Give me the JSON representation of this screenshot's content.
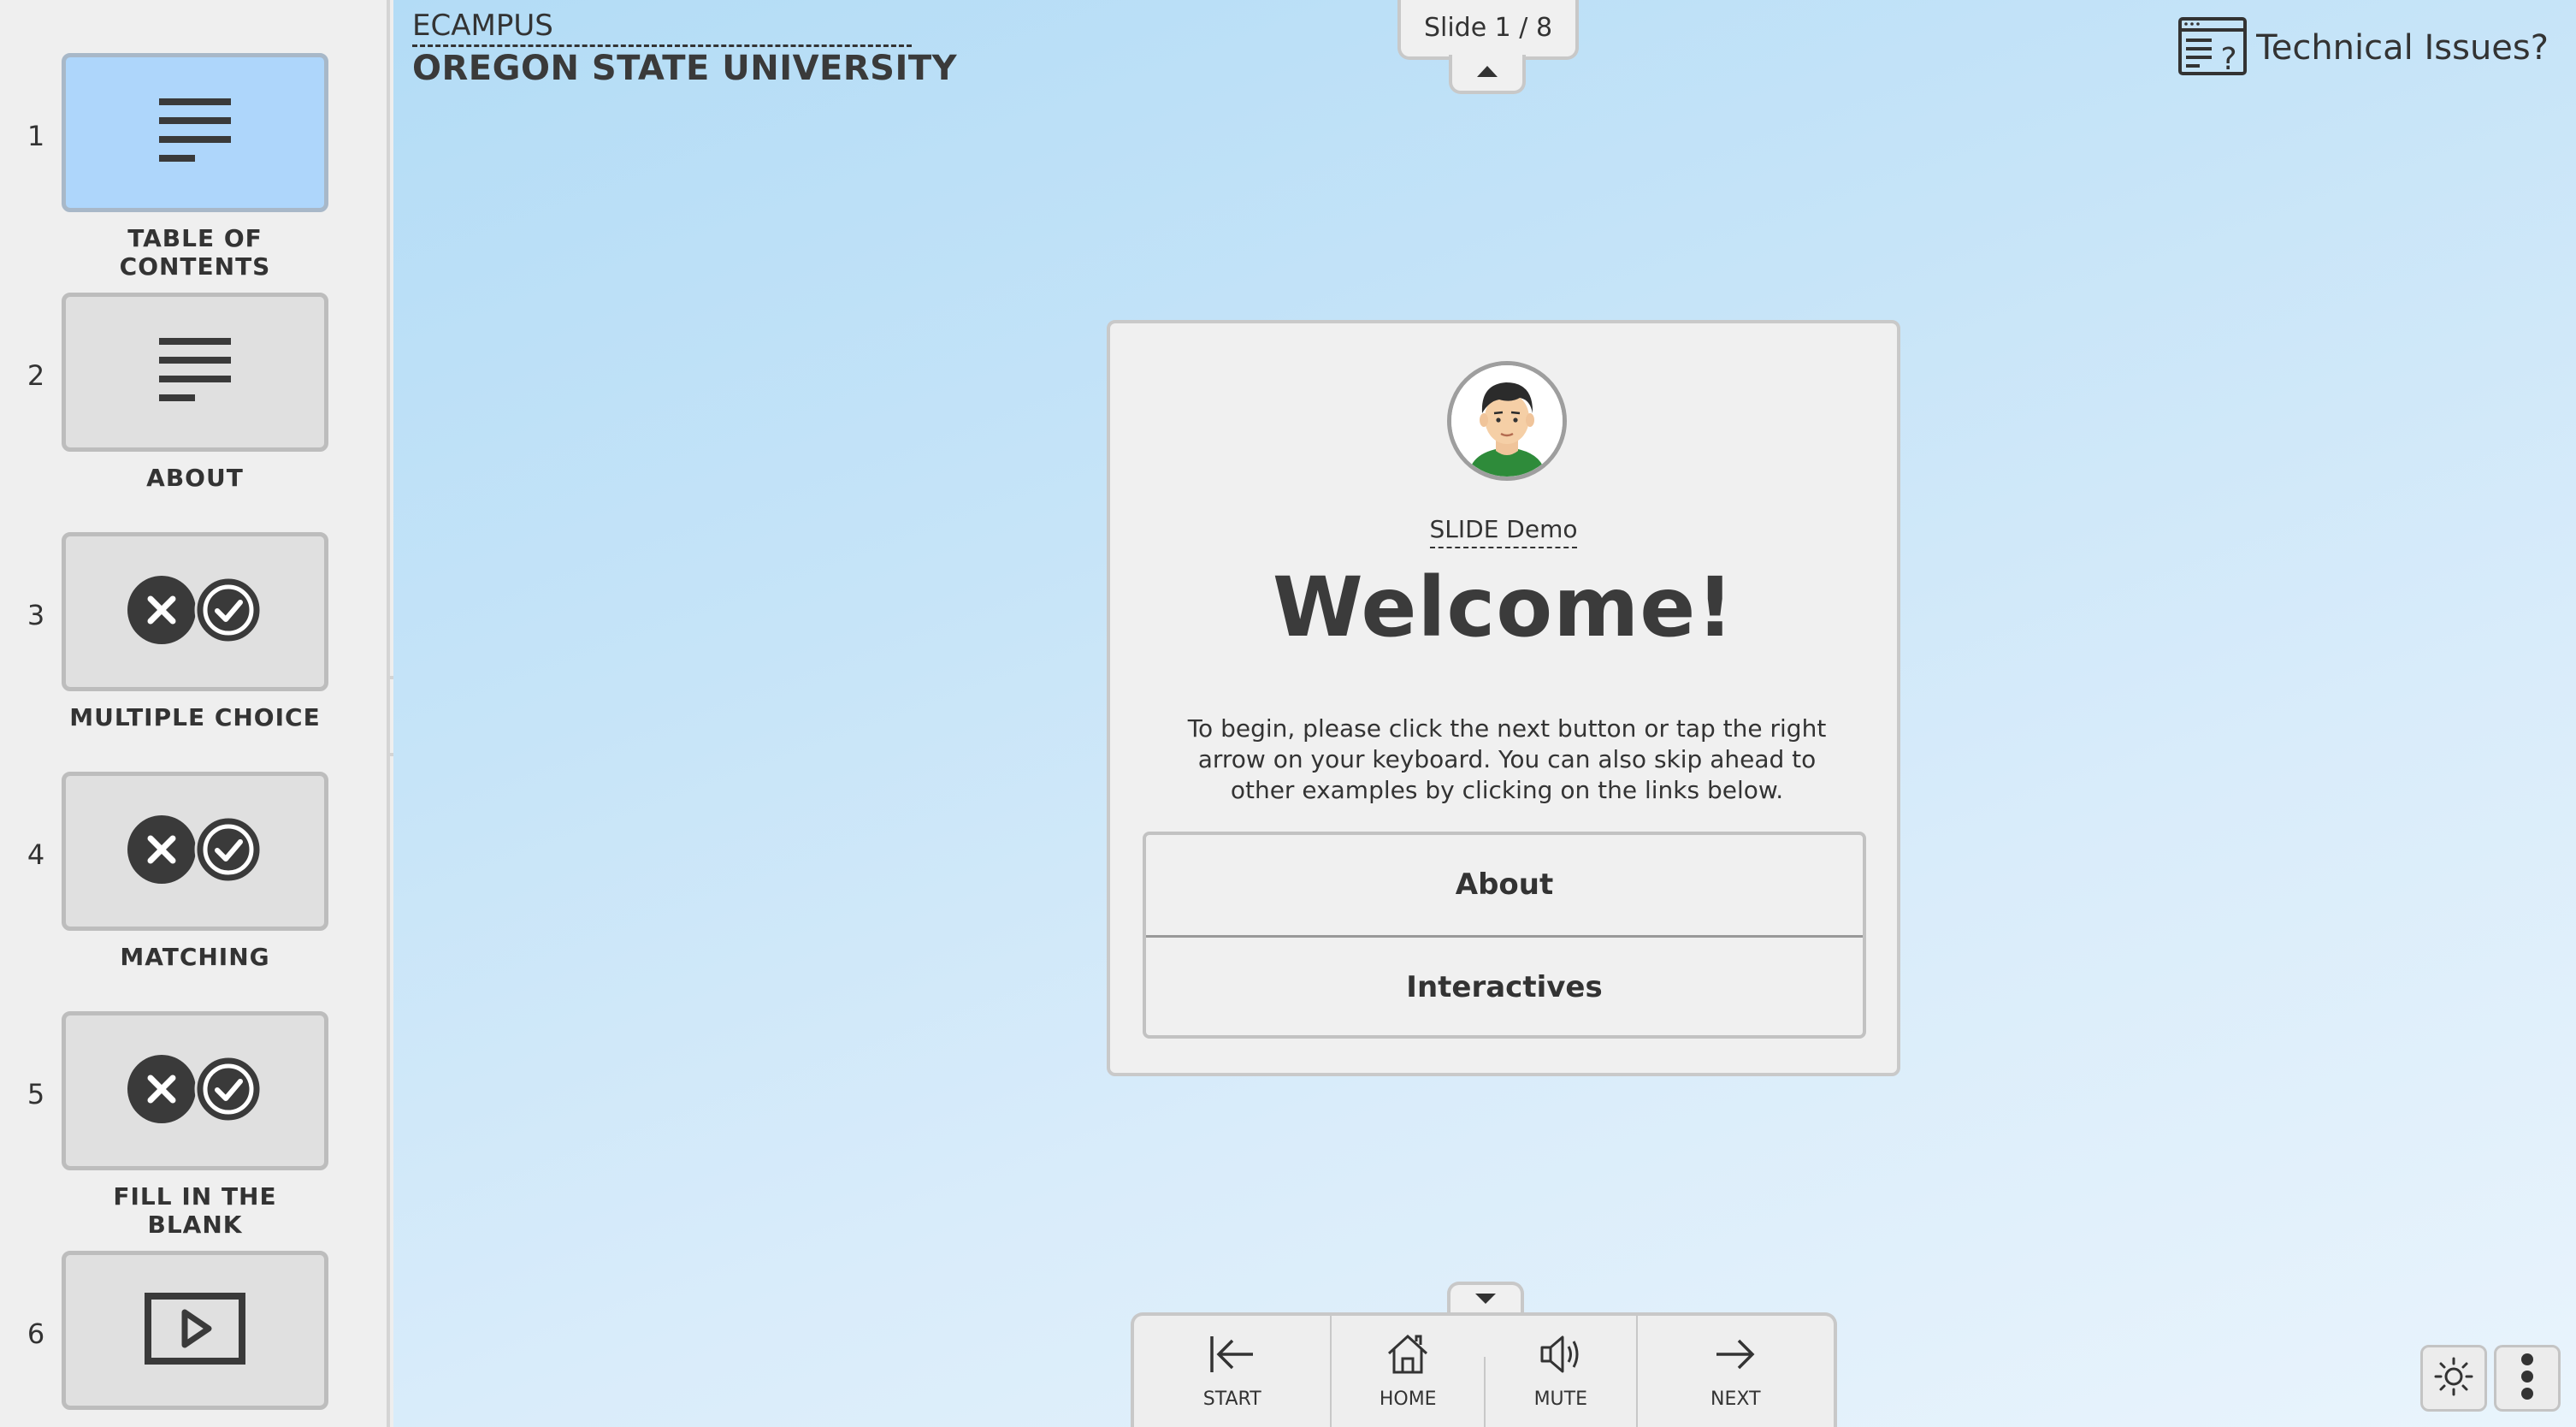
{
  "sidebar": {
    "items": [
      {
        "num": "1",
        "label": "TABLE OF CONTENTS",
        "icon": "text-lines-icon"
      },
      {
        "num": "2",
        "label": "ABOUT",
        "icon": "text-lines-icon"
      },
      {
        "num": "3",
        "label": "MULTIPLE CHOICE",
        "icon": "x-check-icon"
      },
      {
        "num": "4",
        "label": "MATCHING",
        "icon": "x-check-icon"
      },
      {
        "num": "5",
        "label": "FILL IN THE BLANK",
        "icon": "x-check-icon"
      },
      {
        "num": "6",
        "label": "",
        "icon": "play-video-icon"
      }
    ],
    "active_index": 0
  },
  "header": {
    "brand_top": "ECAMPUS",
    "brand_bottom": "OREGON STATE UNIVERSITY",
    "slide_counter": "Slide 1 / 8",
    "tech_issues": "Technical Issues?"
  },
  "card": {
    "subtitle": "SLIDE Demo",
    "title": "Welcome!",
    "body": "To begin, please click the next button or tap the right arrow on your keyboard. You can also skip ahead to other examples by clicking on the links below.",
    "links": [
      "About",
      "Interactives"
    ]
  },
  "nav": {
    "start": "START",
    "home": "HOME",
    "mute": "MUTE",
    "next": "NEXT"
  },
  "colors": {
    "active_thumb": "#aed6fb",
    "icon_dark": "#3a3a3a",
    "bg_gradient_start": "#b3dcf6",
    "bg_gradient_end": "#e9f4fc"
  }
}
